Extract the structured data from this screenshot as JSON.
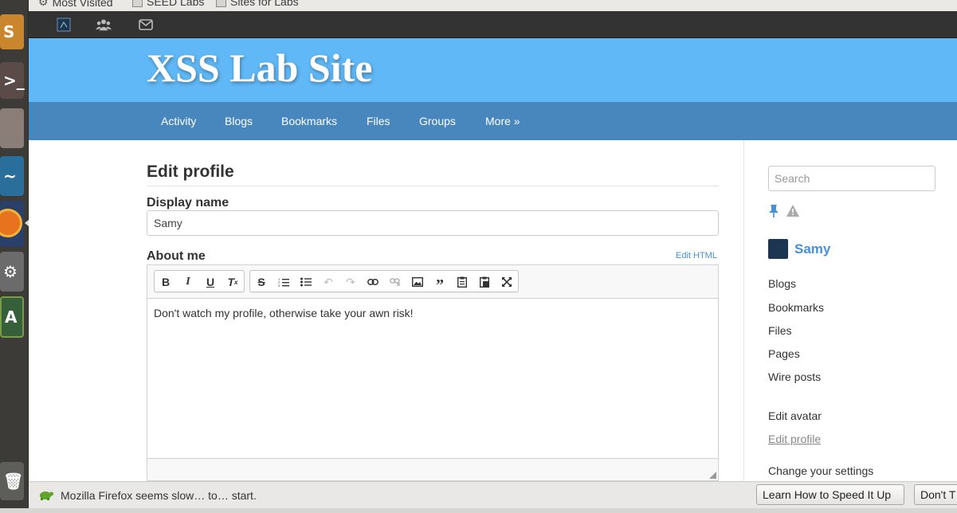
{
  "browser": {
    "bookmarks": [
      "Most Visited",
      "SEED Labs",
      "Sites for Labs"
    ]
  },
  "topbar": {
    "icons": [
      "elgg-logo-icon",
      "friends-icon",
      "messages-icon"
    ]
  },
  "header": {
    "site_title": "XSS Lab Site"
  },
  "nav": {
    "items": [
      "Activity",
      "Blogs",
      "Bookmarks",
      "Files",
      "Groups",
      "More »"
    ]
  },
  "form": {
    "heading": "Edit profile",
    "display_name_label": "Display name",
    "display_name_value": "Samy",
    "about_label": "About me",
    "edit_html_label": "Edit HTML",
    "about_text": "Don't watch my profile, otherwise take your awn risk!"
  },
  "sidebar": {
    "search_placeholder": "Search",
    "owner_name": "Samy",
    "links": [
      "Blogs",
      "Bookmarks",
      "Files",
      "Pages",
      "Wire posts"
    ],
    "edit_links": [
      "Edit avatar",
      "Edit profile",
      "Change your settings"
    ]
  },
  "notification": {
    "text": "Mozilla Firefox seems slow… to… start.",
    "learn_button": "Learn How to Speed It Up",
    "dismiss_button": "Don't T"
  },
  "colors": {
    "header_bg": "#60b8f7",
    "nav_bg": "#4787bd",
    "link": "#4690d6"
  }
}
